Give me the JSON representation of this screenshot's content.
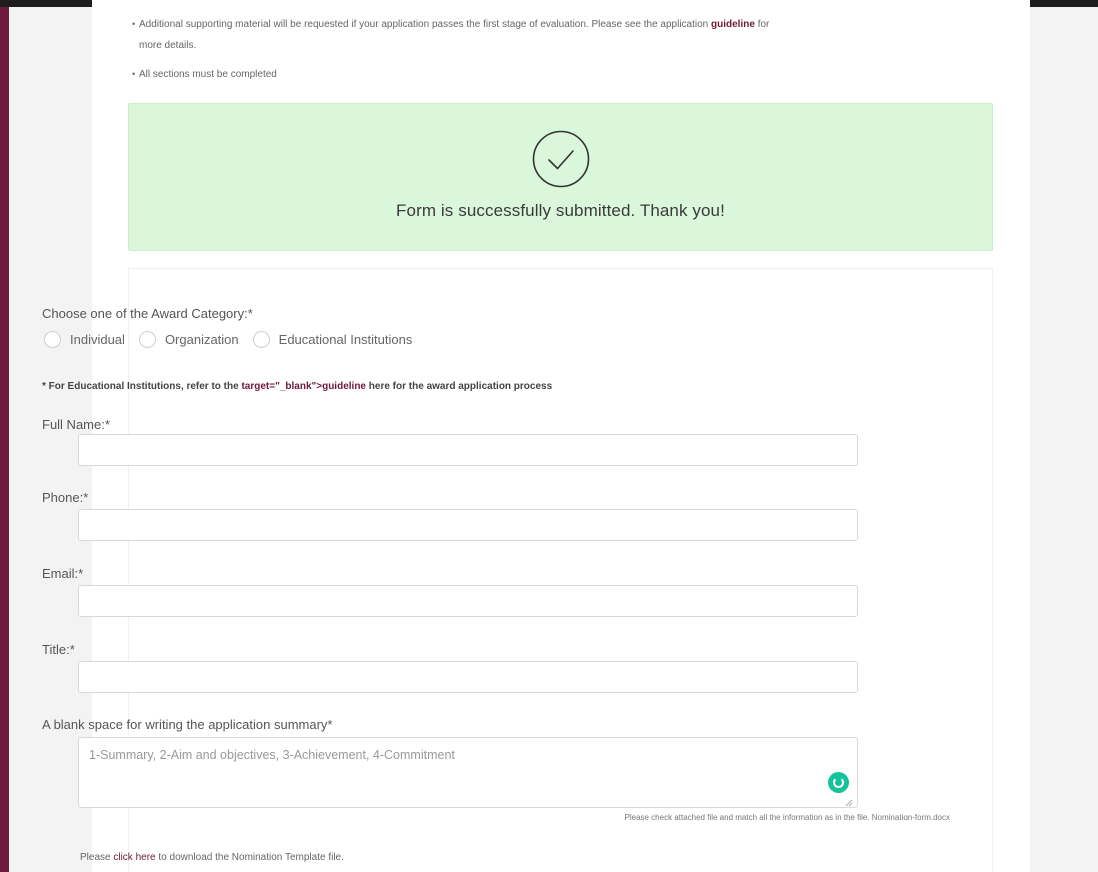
{
  "notes": {
    "line1_before": "Additional supporting material will be requested if your application passes the first stage of evaluation. Please see the application",
    "line1_link": "guideline",
    "line1_after": "for",
    "line1_cont": "more details.",
    "line2": "All sections must be completed"
  },
  "success": {
    "icon": "check-circle-icon",
    "message": "Form is successfully submitted. Thank you!",
    "bg_color": "#dbf7db"
  },
  "form": {
    "category_label": "Choose one of the Award Category:*",
    "categories": [
      "Individual",
      "Organization",
      "Educational Institutions"
    ],
    "edu_note_before": "* For Educational Institutions, refer to the",
    "edu_note_link": "target=\"_blank\">guideline",
    "edu_note_after": "here for the award application process",
    "fields": [
      {
        "label": "Full Name:*",
        "value": ""
      },
      {
        "label": "Phone:*",
        "value": ""
      },
      {
        "label": "Email:*",
        "value": ""
      },
      {
        "label": "Title:*",
        "value": ""
      }
    ],
    "summary_label": "A blank space for writing the application summary*",
    "summary_placeholder": "1-Summary, 2-Aim and objectives, 3-Achievement, 4-Commitment",
    "file_hint": "Please check attached file and match all the information as in the file. Nomination-form.docx",
    "download_before": "Please",
    "download_link": "click here",
    "download_after": "to download the Nomination Template file."
  },
  "colors": {
    "accent": "#6d1a3e",
    "grammarly": "#15c39a"
  }
}
